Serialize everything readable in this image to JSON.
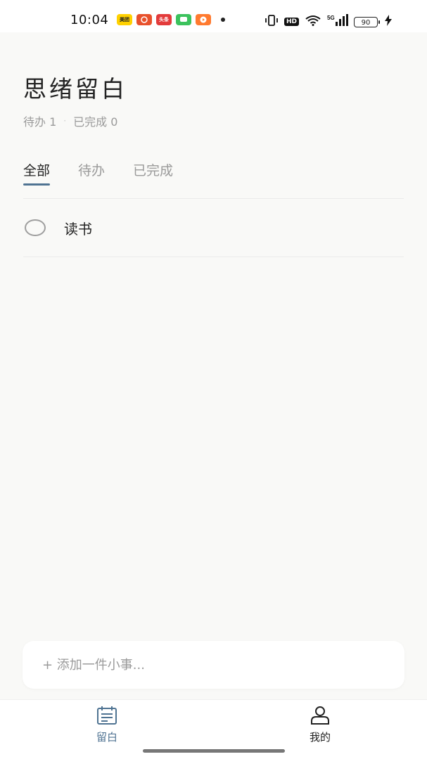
{
  "status_bar": {
    "time": "10:04",
    "notifications": [
      {
        "name": "meituan-icon",
        "label": "美团"
      },
      {
        "name": "pinduoduo-icon",
        "label": ""
      },
      {
        "name": "toutiao-icon",
        "label": "头条"
      },
      {
        "name": "messages-icon",
        "label": ""
      },
      {
        "name": "video-icon",
        "label": ""
      }
    ],
    "hd": "HD",
    "network": "5G",
    "battery": "90"
  },
  "header": {
    "title": "思绪留白",
    "pending_label": "待办 1",
    "separator": "·",
    "done_label": "已完成 0"
  },
  "tabs": [
    {
      "label": "全部",
      "active": true
    },
    {
      "label": "待办",
      "active": false
    },
    {
      "label": "已完成",
      "active": false
    }
  ],
  "todos": [
    {
      "text": "读书",
      "done": false
    }
  ],
  "add_input": {
    "placeholder": "+ 添加一件小事..."
  },
  "bottom_nav": [
    {
      "label": "留白",
      "icon": "notepad-icon",
      "active": true
    },
    {
      "label": "我的",
      "icon": "user-icon",
      "active": false
    }
  ],
  "colors": {
    "accent": "#4f7392",
    "background": "#f9f9f7"
  }
}
